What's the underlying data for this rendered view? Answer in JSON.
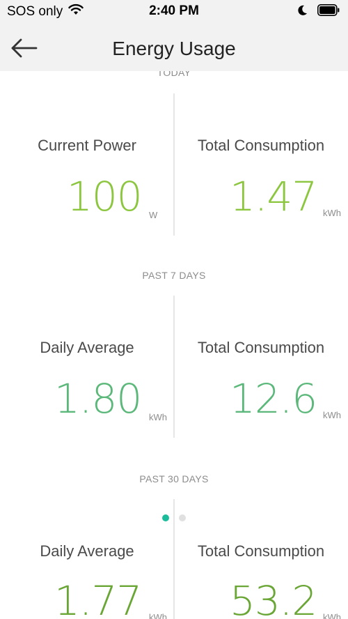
{
  "status_bar": {
    "carrier": "SOS only",
    "time": "2:40 PM",
    "icons": [
      "wifi-icon",
      "moon-icon",
      "battery-icon"
    ]
  },
  "header": {
    "title": "Energy Usage",
    "back_icon": "arrow-left-icon"
  },
  "sections": {
    "today": {
      "label": "TODAY",
      "left_title": "Current Power",
      "left_value": "100",
      "left_unit": "W",
      "right_title": "Total Consumption",
      "right_value": "1.47",
      "right_unit": "kWh"
    },
    "past7": {
      "label": "PAST 7 DAYS",
      "left_title": "Daily Average",
      "left_value": "1.80",
      "left_unit": "kWh",
      "right_title": "Total Consumption",
      "right_value": "12.6",
      "right_unit": "kWh"
    },
    "past30": {
      "label": "PAST 30 DAYS",
      "left_title": "Daily Average",
      "left_value": "1.77",
      "left_unit": "kWh",
      "right_title": "Total Consumption",
      "right_value": "53.2",
      "right_unit": "kWh"
    }
  },
  "pager": {
    "pages": 2,
    "active_index": 0
  },
  "colors": {
    "today_value": "#8cc63f",
    "past7_value": "#5cb87a",
    "past30_value": "#6aa636",
    "pager_active": "#1abc9c",
    "header_bg": "#f2f2f2"
  }
}
